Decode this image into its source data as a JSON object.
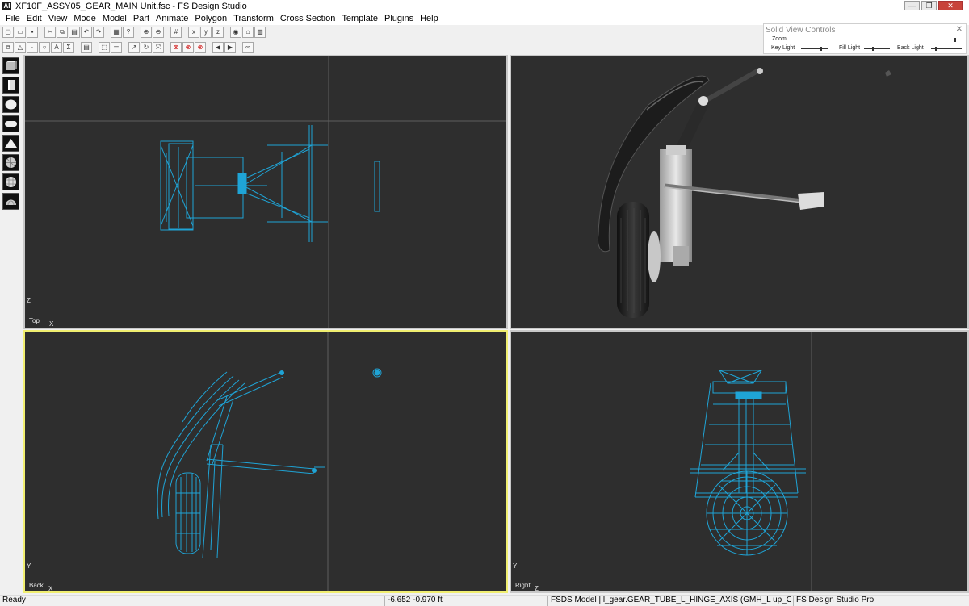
{
  "window": {
    "title": "XF10F_ASSY05_GEAR_MAIN Unit.fsc - FS Design Studio",
    "app_icon": "fsds-icon"
  },
  "menu": [
    "File",
    "Edit",
    "View",
    "Mode",
    "Model",
    "Part",
    "Animate",
    "Polygon",
    "Transform",
    "Cross Section",
    "Template",
    "Plugins",
    "Help"
  ],
  "solid_view_controls": {
    "title": "Solid View Controls",
    "zoom_label": "Zoom",
    "key_light_label": "Key Light",
    "fill_light_label": "Fill Light",
    "back_light_label": "Back Light"
  },
  "viewports": {
    "top": {
      "view_label": "Top",
      "vertical_axis": "Z",
      "horizontal_axis": "X"
    },
    "back": {
      "view_label": "Back",
      "vertical_axis": "Y",
      "horizontal_axis": "X"
    },
    "right": {
      "view_label": "Right",
      "vertical_axis": "Y",
      "horizontal_axis": "Z"
    }
  },
  "status": {
    "ready": "Ready",
    "coords": "-6.652   -0.970 ft",
    "selection": "FSDS Model | l_gear.GEAR_TUBE_L_HINGE_AXIS (GMH_L up_OLEO)",
    "product": "FS Design Studio Pro"
  },
  "colors": {
    "wire": "#1fa4d6",
    "viewport_bg": "#2e2e2e",
    "active_border": "#f0ee70"
  }
}
